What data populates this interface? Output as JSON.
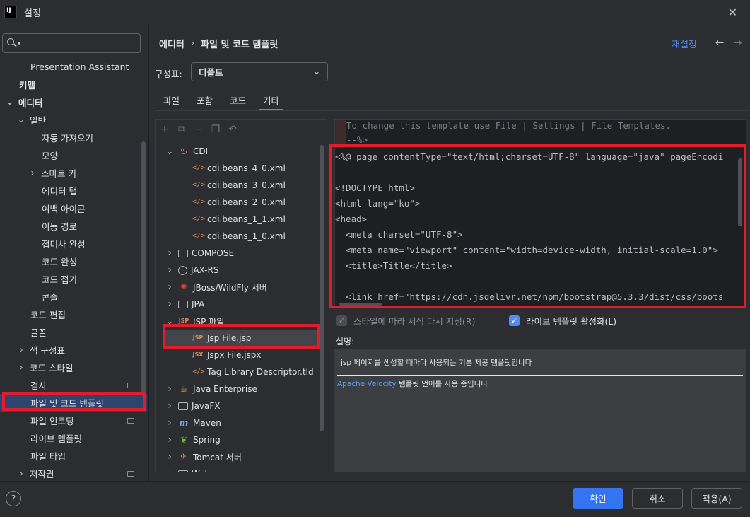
{
  "window": {
    "title": "설정",
    "logo": "IJ"
  },
  "search": {
    "placeholder": ""
  },
  "sidebar": {
    "items": [
      {
        "label": "Presentation Assistant",
        "indent": 2,
        "bold": false
      },
      {
        "label": "키맵",
        "indent": 1,
        "bold": true
      },
      {
        "label": "에디터",
        "indent": 0,
        "bold": true,
        "chev": "expanded"
      },
      {
        "label": "일반",
        "indent": 1,
        "chev": "expanded"
      },
      {
        "label": "자동 가져오기",
        "indent": 3
      },
      {
        "label": "모양",
        "indent": 3
      },
      {
        "label": "스마트 키",
        "indent": 2,
        "chev": "collapsed"
      },
      {
        "label": "에디터 탭",
        "indent": 3
      },
      {
        "label": "여백 아이콘",
        "indent": 3
      },
      {
        "label": "이동 경로",
        "indent": 3
      },
      {
        "label": "접미사 완성",
        "indent": 3
      },
      {
        "label": "코드 완성",
        "indent": 3
      },
      {
        "label": "코드 접기",
        "indent": 3
      },
      {
        "label": "콘솔",
        "indent": 3
      },
      {
        "label": "코드 편집",
        "indent": 2
      },
      {
        "label": "글꼴",
        "indent": 2
      },
      {
        "label": "색 구성표",
        "indent": 1,
        "chev": "collapsed"
      },
      {
        "label": "코드 스타일",
        "indent": 1,
        "chev": "collapsed"
      },
      {
        "label": "검사",
        "indent": 2,
        "page": true
      },
      {
        "label": "파일 및 코드 템플릿",
        "indent": 2,
        "selected": true
      },
      {
        "label": "파일 인코딩",
        "indent": 2,
        "page": true
      },
      {
        "label": "라이브 템플릿",
        "indent": 2
      },
      {
        "label": "파일 타입",
        "indent": 2
      },
      {
        "label": "저작권",
        "indent": 1,
        "chev": "collapsed",
        "page": true
      }
    ]
  },
  "breadcrumb": {
    "parent": "에디터",
    "separator": "›",
    "current": "파일 및 코드 템플릿"
  },
  "header": {
    "reset_label": "재설정",
    "back_icon": "←",
    "forward_icon": "→"
  },
  "scheme": {
    "label": "구성표:",
    "value": "디폴트"
  },
  "tabs": [
    {
      "label": "파일",
      "active": false
    },
    {
      "label": "포함",
      "active": false
    },
    {
      "label": "코드",
      "active": false
    },
    {
      "label": "기타",
      "active": true
    }
  ],
  "toolbar": {
    "add": "+",
    "copy": "⧉",
    "remove": "−",
    "duplicate": "❐",
    "reset": "↶"
  },
  "tree": {
    "items": [
      {
        "label": "CDI",
        "level": 0,
        "chev": "expanded",
        "icon": "cdi"
      },
      {
        "label": "cdi.beans_4_0.xml",
        "level": 1,
        "icon": "xml"
      },
      {
        "label": "cdi.beans_3_0.xml",
        "level": 1,
        "icon": "xml"
      },
      {
        "label": "cdi.beans_2_0.xml",
        "level": 1,
        "icon": "xml"
      },
      {
        "label": "cdi.beans_1_1.xml",
        "level": 1,
        "icon": "xml"
      },
      {
        "label": "cdi.beans_1_0.xml",
        "level": 1,
        "icon": "xml"
      },
      {
        "label": "COMPOSE",
        "level": 0,
        "chev": "collapsed",
        "icon": "folder"
      },
      {
        "label": "JAX-RS",
        "level": 0,
        "chev": "collapsed",
        "icon": "globe"
      },
      {
        "label": "JBoss/WildFly 서버",
        "level": 0,
        "chev": "collapsed",
        "icon": "red"
      },
      {
        "label": "JPA",
        "level": 0,
        "chev": "collapsed",
        "icon": "folder"
      },
      {
        "label": "JSP 파일",
        "level": 0,
        "chev": "expanded",
        "icon": "jsp"
      },
      {
        "label": "Jsp File.jsp",
        "level": 1,
        "icon": "jsp",
        "selected": true
      },
      {
        "label": "Jspx File.jspx",
        "level": 1,
        "icon": "jsx"
      },
      {
        "label": "Tag Library Descriptor.tld",
        "level": 1,
        "icon": "xml"
      },
      {
        "label": "Java Enterprise",
        "level": 0,
        "chev": "collapsed",
        "icon": "yellow"
      },
      {
        "label": "JavaFX",
        "level": 0,
        "chev": "collapsed",
        "icon": "folder"
      },
      {
        "label": "Maven",
        "level": 0,
        "chev": "collapsed",
        "icon": "blue"
      },
      {
        "label": "Spring",
        "level": 0,
        "chev": "collapsed",
        "icon": "green"
      },
      {
        "label": "Tomcat 서버",
        "level": 0,
        "chev": "collapsed",
        "icon": "orange"
      },
      {
        "label": "Web",
        "level": 0,
        "chev": "collapsed",
        "icon": "folder"
      }
    ]
  },
  "icons": {
    "xml": "</>",
    "jsp": "JSP",
    "jsx": "JSX",
    "cdi": "♋",
    "red": "✺",
    "blue": "m",
    "green": "❦",
    "yellow": "☕",
    "orange": "✈"
  },
  "editor": {
    "lines": [
      {
        "text": "To change this template use File | Settings | File Templates.",
        "comment": true
      },
      {
        "text": "--%>",
        "comment": true
      },
      {
        "text": "<%@ page contentType=\"text/html;charset=UTF-8\" language=\"java\" pageEncodi"
      },
      {
        "text": ""
      },
      {
        "text": "<!DOCTYPE html>"
      },
      {
        "text": "<html lang=\"ko\">"
      },
      {
        "text": "<head>"
      },
      {
        "text": "  <meta charset=\"UTF-8\">"
      },
      {
        "text": "  <meta name=\"viewport\" content=\"width=device-width, initial-scale=1.0\">"
      },
      {
        "text": "  <title>Title</title>"
      },
      {
        "text": ""
      },
      {
        "text": "  <link href=\"https://cdn.jsdelivr.net/npm/bootstrap@5.3.3/dist/css/boots"
      }
    ]
  },
  "options": {
    "reformat_label": "스타일에 따라 서식 다시 지정(R)",
    "live_template_label": "라이브 템플릿 활성화(L)",
    "check_mark": "✓"
  },
  "description": {
    "label": "설명:",
    "main": "jsp 페이지를 생성할 때마다 사용되는 기본 제공 템플릿입니다",
    "link": "Apache Velocity",
    "link_suffix": " 템플릿 언어를 사용 중입니다"
  },
  "footer": {
    "help": "?",
    "ok_label": "확인",
    "cancel_label": "취소",
    "apply_label": "적용(A)"
  },
  "colors": {
    "accent": "#548af7",
    "primary_button": "#3574f0",
    "highlight_box": "#e11d2b",
    "selection": "#2e436e"
  }
}
